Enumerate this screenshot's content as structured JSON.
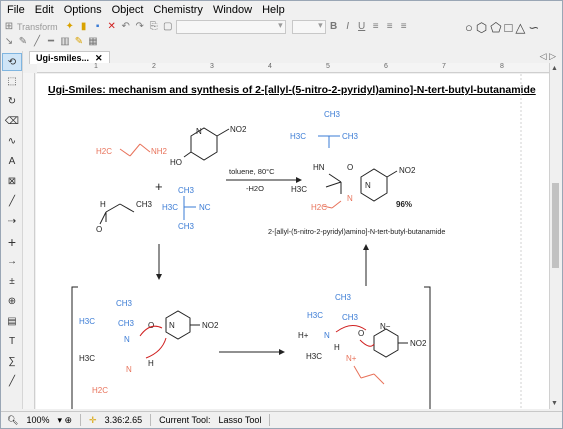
{
  "menu": [
    "File",
    "Edit",
    "Options",
    "Object",
    "Chemistry",
    "Window",
    "Help"
  ],
  "toolbar": {
    "transform_label": "Transform"
  },
  "tab": {
    "label": "Ugi-smiles...",
    "close": "✕"
  },
  "ruler_marks": [
    "1",
    "2",
    "3",
    "4",
    "5",
    "6",
    "7",
    "8"
  ],
  "document": {
    "title": "Ugi-Smiles: mechanism and synthesis of 2-[allyl-(5-nitro-2-pyridyl)amino]-N-tert-butyl-butanamide",
    "conditions": "toluene, 80°C",
    "byproduct": "-H2O",
    "yield": "96%",
    "product_name": "2-[allyl-(5-nitro-2-pyridyl)amino]-N-tert-butyl-butanamide",
    "plus": "+",
    "labels": {
      "nh2": "NH2",
      "no2": "NO2",
      "ho": "HO",
      "n": "N",
      "nc": "NC",
      "o": "O",
      "h": "H",
      "hplus": "H+",
      "ch3": "CH3",
      "h3c": "H3C",
      "h2c": "H2C",
      "hn": "HN",
      "neg": "N−",
      "npos": "N+"
    }
  },
  "status": {
    "zoom": "100%",
    "coords": "3.36:2.65",
    "current_tool_label": "Current Tool:",
    "current_tool": "Lasso Tool"
  },
  "colors": {
    "reactant_red": "#e8725a",
    "mechanism_blue": "#3a7bd5",
    "canvas": "#ffffff",
    "chrome": "#f0f0f0"
  }
}
